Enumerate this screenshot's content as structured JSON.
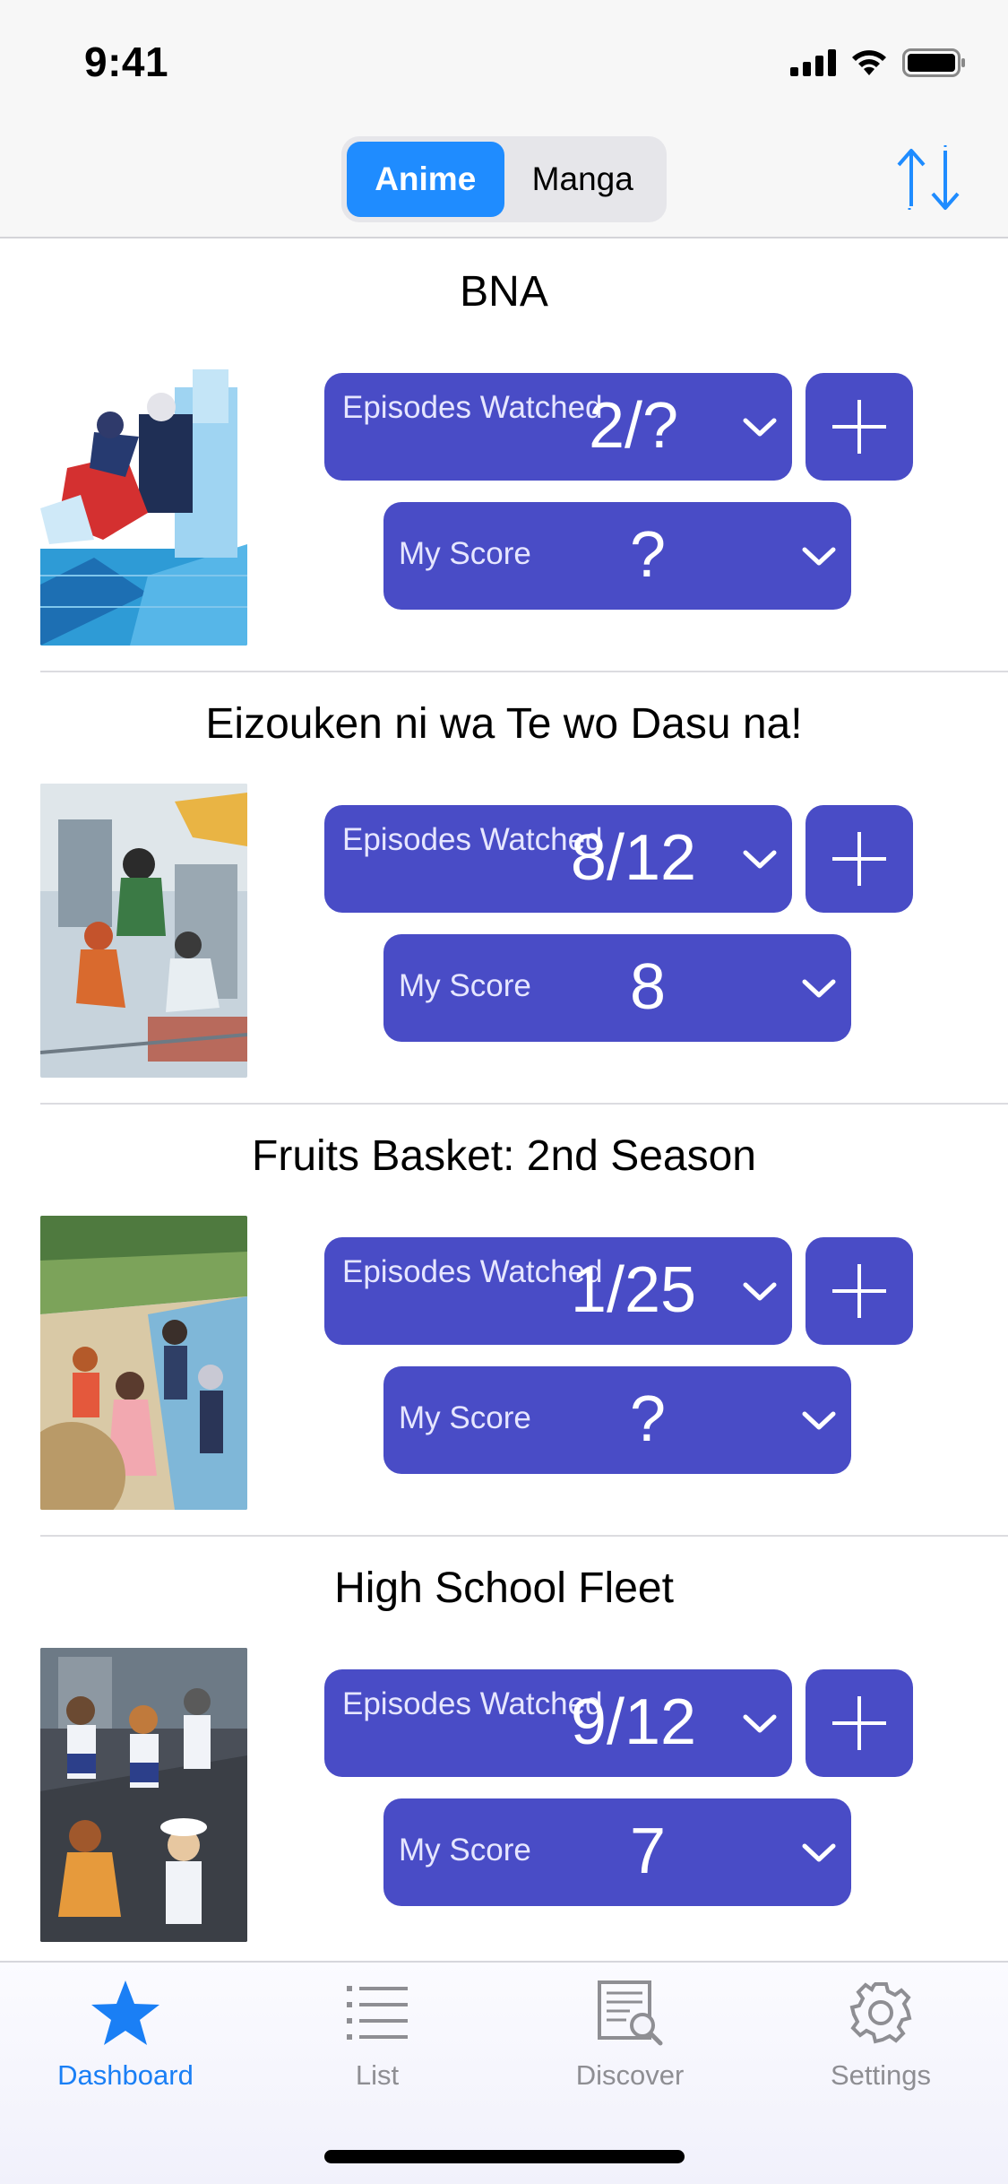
{
  "status_bar": {
    "time": "9:41"
  },
  "nav": {
    "segments": [
      {
        "label": "Anime",
        "selected": true
      },
      {
        "label": "Manga",
        "selected": false
      }
    ],
    "sort_icon": "sort-arrows-icon"
  },
  "cards": [
    {
      "title": "BNA",
      "episodes_label": "Episodes Watched",
      "episodes_value": "2/?",
      "score_label": "My Score",
      "score_value": "?"
    },
    {
      "title": "Eizouken ni wa Te wo Dasu na!",
      "episodes_label": "Episodes Watched",
      "episodes_value": "8/12",
      "score_label": "My Score",
      "score_value": "8"
    },
    {
      "title": "Fruits Basket: 2nd Season",
      "episodes_label": "Episodes Watched",
      "episodes_value": "1/25",
      "score_label": "My Score",
      "score_value": "?"
    },
    {
      "title": "High School Fleet",
      "episodes_label": "Episodes Watched",
      "episodes_value": "9/12",
      "score_label": "My Score",
      "score_value": "7"
    }
  ],
  "tab_bar": {
    "tabs": [
      {
        "label": "Dashboard",
        "icon": "star-icon",
        "active": true
      },
      {
        "label": "List",
        "icon": "list-icon",
        "active": false
      },
      {
        "label": "Discover",
        "icon": "discover-icon",
        "active": false
      },
      {
        "label": "Settings",
        "icon": "gear-icon",
        "active": false
      }
    ]
  },
  "colors": {
    "accent": "#1f8cff",
    "pill": "#494cc6",
    "tab_active": "#1a7ff5",
    "tab_inactive": "#8e8e93"
  }
}
